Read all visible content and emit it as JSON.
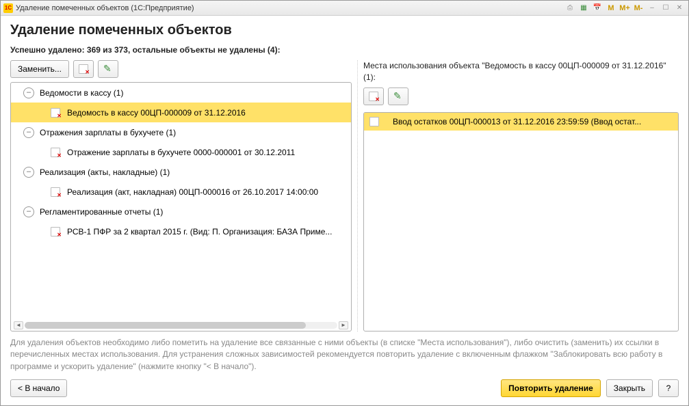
{
  "titlebar": {
    "logo_text": "1C",
    "title": "Удаление помеченных объектов  (1С:Предприятие)",
    "icons": {
      "print": "print-icon",
      "calc": "calculator-icon",
      "calendar": "calendar-icon",
      "m": "M",
      "mplus": "M+",
      "mminus": "M-",
      "min": "–",
      "max": "☐",
      "close": "✕"
    }
  },
  "heading": "Удаление помеченных объектов",
  "subheading": "Успешно удалено: 369 из 373, остальные объекты не удалены (4):",
  "left_toolbar": {
    "replace": "Заменить..."
  },
  "tree": {
    "groups": [
      {
        "label": "Ведомости в кассу (1)",
        "items": [
          {
            "label": "Ведомость в кассу 00ЦП-000009 от 31.12.2016",
            "selected": true
          }
        ]
      },
      {
        "label": "Отражения зарплаты в бухучете (1)",
        "items": [
          {
            "label": "Отражение зарплаты в бухучете 0000-000001 от 30.12.2011"
          }
        ]
      },
      {
        "label": "Реализация (акты, накладные) (1)",
        "items": [
          {
            "label": "Реализация (акт, накладная) 00ЦП-000016 от 26.10.2017 14:00:00"
          }
        ]
      },
      {
        "label": "Регламентированные отчеты (1)",
        "items": [
          {
            "label": "РСВ-1 ПФР за 2 квартал 2015 г. (Вид: П. Организация: БАЗА Приме..."
          }
        ]
      }
    ]
  },
  "right_panel": {
    "label": "Места использования объекта \"Ведомость в кассу 00ЦП-000009 от 31.12.2016\" (1):",
    "items": [
      {
        "label": "Ввод остатков 00ЦП-000013 от 31.12.2016 23:59:59 (Ввод остат..."
      }
    ]
  },
  "footer_text": "Для удаления объектов необходимо либо пометить на удаление все связанные с ними объекты (в списке \"Места использования\"), либо очистить (заменить) их ссылки в перечисленных местах использования. Для устранения сложных зависимостей рекомендуется повторить удаление с включенным флажком \"Заблокировать всю работу в программе и ускорить удаление\" (нажмите кнопку \"< В начало\").",
  "footer_buttons": {
    "back": "< В начало",
    "retry": "Повторить удаление",
    "close": "Закрыть",
    "help": "?"
  }
}
